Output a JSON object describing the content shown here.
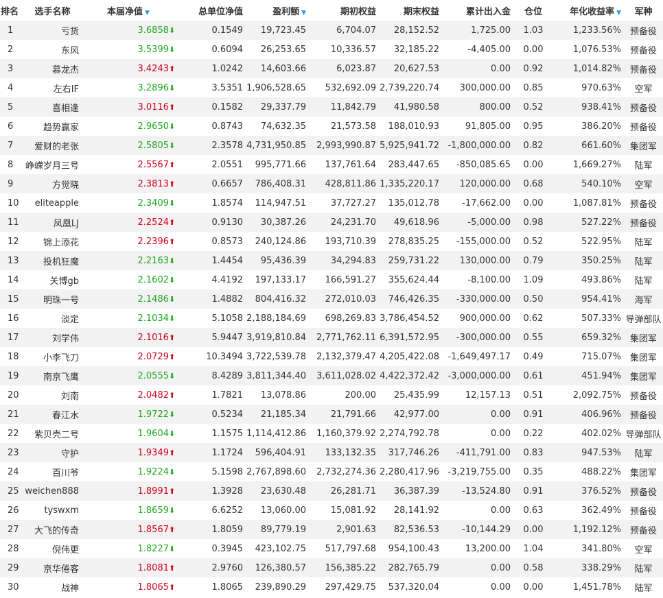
{
  "headers": {
    "rank": "排名",
    "name": "选手名称",
    "nav": "本届净值",
    "unit_nav": "总单位净值",
    "profit": "盈利额",
    "start_equity": "期初权益",
    "end_equity": "期末权益",
    "net_flow": "累计出入金",
    "position": "仓位",
    "annual_return": "年化收益率",
    "army": "军种"
  },
  "sort_icon": "▼",
  "icons": {
    "up": "arrow-up-icon",
    "down": "arrow-down-icon",
    "sort": "sort-desc-icon"
  },
  "colors": {
    "up": "#d0021b",
    "down": "#1fa81f",
    "sort": "#2f9ae0",
    "stripe": "#f2f2f2"
  },
  "rows": [
    {
      "rank": "1",
      "name": "亏货",
      "nav": "3.6858",
      "dir": "down",
      "unit_nav": "0.1549",
      "profit": "19,723.45",
      "start": "6,704.07",
      "end": "28,152.52",
      "flow": "1,725.00",
      "pos": "1.03",
      "annual": "1,233.56%",
      "army": "预备役"
    },
    {
      "rank": "2",
      "name": "东风",
      "nav": "3.5399",
      "dir": "down",
      "unit_nav": "0.6094",
      "profit": "26,253.65",
      "start": "10,336.57",
      "end": "32,185.22",
      "flow": "-4,405.00",
      "pos": "0.00",
      "annual": "1,076.53%",
      "army": "预备役"
    },
    {
      "rank": "3",
      "name": "慕龙杰",
      "nav": "3.4243",
      "dir": "up",
      "unit_nav": "1.0242",
      "profit": "14,603.66",
      "start": "6,023.87",
      "end": "20,627.53",
      "flow": "0.00",
      "pos": "0.92",
      "annual": "1,014.82%",
      "army": "预备役"
    },
    {
      "rank": "4",
      "name": "左右IF",
      "nav": "3.2896",
      "dir": "down",
      "unit_nav": "3.5351",
      "profit": "1,906,528.65",
      "start": "532,692.09",
      "end": "2,739,220.74",
      "flow": "300,000.00",
      "pos": "0.85",
      "annual": "970.63%",
      "army": "空军"
    },
    {
      "rank": "5",
      "name": "喜相逢",
      "nav": "3.0116",
      "dir": "up",
      "unit_nav": "0.1582",
      "profit": "29,337.79",
      "start": "11,842.79",
      "end": "41,980.58",
      "flow": "800.00",
      "pos": "0.52",
      "annual": "938.41%",
      "army": "预备役"
    },
    {
      "rank": "6",
      "name": "趋势赢家",
      "nav": "2.9650",
      "dir": "down",
      "unit_nav": "0.8743",
      "profit": "74,632.35",
      "start": "21,573.58",
      "end": "188,010.93",
      "flow": "91,805.00",
      "pos": "0.95",
      "annual": "386.20%",
      "army": "预备役"
    },
    {
      "rank": "7",
      "name": "爱财的老张",
      "nav": "2.5805",
      "dir": "down",
      "unit_nav": "2.3578",
      "profit": "4,731,950.85",
      "start": "2,993,990.87",
      "end": "5,925,941.72",
      "flow": "-1,800,000.00",
      "pos": "0.82",
      "annual": "661.60%",
      "army": "集团军"
    },
    {
      "rank": "8",
      "name": "峥嵘岁月三号",
      "nav": "2.5567",
      "dir": "up",
      "unit_nav": "2.0551",
      "profit": "995,771.66",
      "start": "137,761.64",
      "end": "283,447.65",
      "flow": "-850,085.65",
      "pos": "0.00",
      "annual": "1,669.27%",
      "army": "陆军"
    },
    {
      "rank": "9",
      "name": "方觉晓",
      "nav": "2.3813",
      "dir": "up",
      "unit_nav": "0.6657",
      "profit": "786,408.31",
      "start": "428,811.86",
      "end": "1,335,220.17",
      "flow": "120,000.00",
      "pos": "0.68",
      "annual": "540.10%",
      "army": "空军"
    },
    {
      "rank": "10",
      "name": "eliteapple",
      "nav": "2.3409",
      "dir": "down",
      "unit_nav": "1.8574",
      "profit": "114,947.51",
      "start": "37,727.27",
      "end": "135,012.78",
      "flow": "-17,662.00",
      "pos": "0.00",
      "annual": "1,087.81%",
      "army": "预备役"
    },
    {
      "rank": "11",
      "name": "凤凰LJ",
      "nav": "2.2524",
      "dir": "up",
      "unit_nav": "0.9130",
      "profit": "30,387.26",
      "start": "24,231.70",
      "end": "49,618.96",
      "flow": "-5,000.00",
      "pos": "0.98",
      "annual": "527.22%",
      "army": "预备役"
    },
    {
      "rank": "12",
      "name": "锦上添花",
      "nav": "2.2396",
      "dir": "up",
      "unit_nav": "0.8573",
      "profit": "240,124.86",
      "start": "193,710.39",
      "end": "278,835.25",
      "flow": "-155,000.00",
      "pos": "0.52",
      "annual": "522.95%",
      "army": "陆军"
    },
    {
      "rank": "13",
      "name": "投机狂魔",
      "nav": "2.2163",
      "dir": "down",
      "unit_nav": "1.4454",
      "profit": "95,436.39",
      "start": "34,294.83",
      "end": "259,731.22",
      "flow": "130,000.00",
      "pos": "0.79",
      "annual": "350.25%",
      "army": "陆军"
    },
    {
      "rank": "14",
      "name": "关博gb",
      "nav": "2.1602",
      "dir": "down",
      "unit_nav": "4.4192",
      "profit": "197,133.17",
      "start": "166,591.27",
      "end": "355,624.44",
      "flow": "-8,100.00",
      "pos": "1.09",
      "annual": "493.86%",
      "army": "陆军"
    },
    {
      "rank": "15",
      "name": "明珠一号",
      "nav": "2.1486",
      "dir": "down",
      "unit_nav": "1.4882",
      "profit": "804,416.32",
      "start": "272,010.03",
      "end": "746,426.35",
      "flow": "-330,000.00",
      "pos": "0.50",
      "annual": "954.41%",
      "army": "海军"
    },
    {
      "rank": "16",
      "name": "淡定",
      "nav": "2.1034",
      "dir": "down",
      "unit_nav": "5.1058",
      "profit": "2,188,184.69",
      "start": "698,269.83",
      "end": "3,786,454.52",
      "flow": "900,000.00",
      "pos": "0.62",
      "annual": "507.33%",
      "army": "导弹部队"
    },
    {
      "rank": "17",
      "name": "刘学伟",
      "nav": "2.1016",
      "dir": "up",
      "unit_nav": "5.9447",
      "profit": "3,919,810.84",
      "start": "2,771,762.11",
      "end": "6,391,572.95",
      "flow": "-300,000.00",
      "pos": "0.55",
      "annual": "659.32%",
      "army": "集团军"
    },
    {
      "rank": "18",
      "name": "小李飞刀",
      "nav": "2.0729",
      "dir": "up",
      "unit_nav": "10.3494",
      "profit": "3,722,539.78",
      "start": "2,132,379.47",
      "end": "4,205,422.08",
      "flow": "-1,649,497.17",
      "pos": "0.49",
      "annual": "715.07%",
      "army": "集团军"
    },
    {
      "rank": "19",
      "name": "南京飞鹰",
      "nav": "2.0555",
      "dir": "down",
      "unit_nav": "8.4289",
      "profit": "3,811,344.40",
      "start": "3,611,028.02",
      "end": "4,422,372.42",
      "flow": "-3,000,000.00",
      "pos": "0.61",
      "annual": "451.94%",
      "army": "集团军"
    },
    {
      "rank": "20",
      "name": "刘南",
      "nav": "2.0482",
      "dir": "up",
      "unit_nav": "1.7821",
      "profit": "13,078.86",
      "start": "200.00",
      "end": "25,435.99",
      "flow": "12,157.13",
      "pos": "0.51",
      "annual": "2,092.75%",
      "army": "预备役"
    },
    {
      "rank": "21",
      "name": "春江水",
      "nav": "1.9722",
      "dir": "down",
      "unit_nav": "0.5234",
      "profit": "21,185.34",
      "start": "21,791.66",
      "end": "42,977.00",
      "flow": "0.00",
      "pos": "0.91",
      "annual": "406.96%",
      "army": "预备役"
    },
    {
      "rank": "22",
      "name": "紫贝壳二号",
      "nav": "1.9604",
      "dir": "down",
      "unit_nav": "1.1575",
      "profit": "1,114,412.86",
      "start": "1,160,379.92",
      "end": "2,274,792.78",
      "flow": "0.00",
      "pos": "0.22",
      "annual": "402.02%",
      "army": "导弹部队"
    },
    {
      "rank": "23",
      "name": "守护",
      "nav": "1.9349",
      "dir": "up",
      "unit_nav": "1.1724",
      "profit": "596,404.91",
      "start": "133,132.35",
      "end": "317,746.26",
      "flow": "-411,791.00",
      "pos": "0.83",
      "annual": "947.53%",
      "army": "陆军"
    },
    {
      "rank": "24",
      "name": "百川爷",
      "nav": "1.9224",
      "dir": "down",
      "unit_nav": "5.1598",
      "profit": "2,767,898.60",
      "start": "2,732,274.36",
      "end": "2,280,417.96",
      "flow": "-3,219,755.00",
      "pos": "0.35",
      "annual": "488.22%",
      "army": "集团军"
    },
    {
      "rank": "25",
      "name": "weichen888",
      "nav": "1.8991",
      "dir": "up",
      "unit_nav": "1.3928",
      "profit": "23,630.48",
      "start": "26,281.71",
      "end": "36,387.39",
      "flow": "-13,524.80",
      "pos": "0.91",
      "annual": "376.52%",
      "army": "预备役"
    },
    {
      "rank": "26",
      "name": "tyswxm",
      "nav": "1.8659",
      "dir": "down",
      "unit_nav": "6.6252",
      "profit": "13,060.00",
      "start": "15,081.92",
      "end": "28,141.92",
      "flow": "0.00",
      "pos": "0.63",
      "annual": "362.49%",
      "army": "预备役"
    },
    {
      "rank": "27",
      "name": "大飞的传奇",
      "nav": "1.8567",
      "dir": "up",
      "unit_nav": "1.8059",
      "profit": "89,779.19",
      "start": "2,901.63",
      "end": "82,536.53",
      "flow": "-10,144.29",
      "pos": "0.00",
      "annual": "1,192.12%",
      "army": "预备役"
    },
    {
      "rank": "28",
      "name": "倪伟更",
      "nav": "1.8227",
      "dir": "down",
      "unit_nav": "0.3945",
      "profit": "423,102.75",
      "start": "517,797.68",
      "end": "954,100.43",
      "flow": "13,200.00",
      "pos": "1.04",
      "annual": "341.80%",
      "army": "空军"
    },
    {
      "rank": "29",
      "name": "京华倦客",
      "nav": "1.8081",
      "dir": "up",
      "unit_nav": "2.9760",
      "profit": "126,380.57",
      "start": "156,385.22",
      "end": "282,765.79",
      "flow": "0.00",
      "pos": "0.58",
      "annual": "338.29%",
      "army": "陆军"
    },
    {
      "rank": "30",
      "name": "战神",
      "nav": "1.8065",
      "dir": "up",
      "unit_nav": "1.8065",
      "profit": "239,890.29",
      "start": "297,429.75",
      "end": "537,320.04",
      "flow": "0.00",
      "pos": "0.00",
      "annual": "1,451.78%",
      "army": "陆军"
    }
  ]
}
